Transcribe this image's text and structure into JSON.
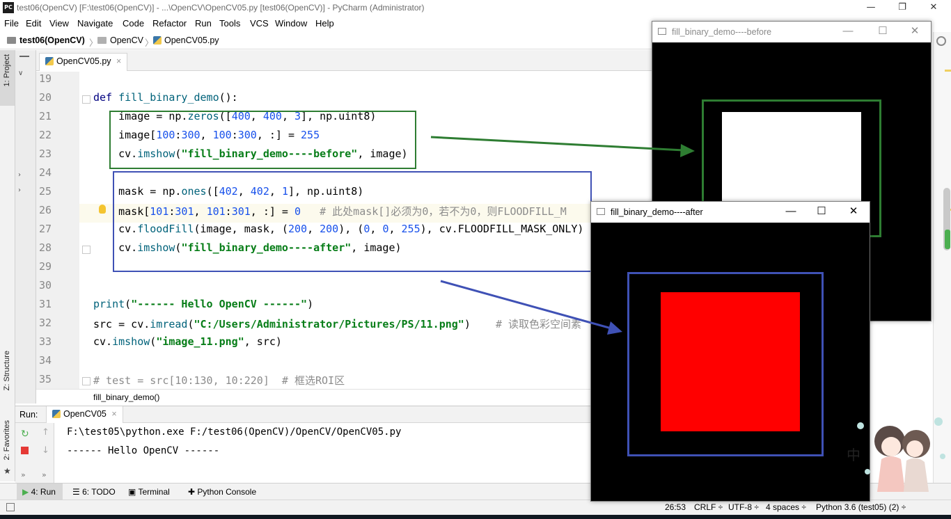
{
  "titlebar": {
    "app_icon": "PC",
    "title": "test06(OpenCV) [F:\\test06(OpenCV)] - ...\\OpenCV\\OpenCV05.py [test06(OpenCV)] - PyCharm (Administrator)",
    "minimize": "—",
    "restore": "❐",
    "close": "✕"
  },
  "menu": [
    "File",
    "Edit",
    "View",
    "Navigate",
    "Code",
    "Refactor",
    "Run",
    "Tools",
    "VCS",
    "Window",
    "Help"
  ],
  "breadcrumb": {
    "project": "test06(OpenCV)",
    "folder": "OpenCV",
    "file": "OpenCV05.py"
  },
  "left_tools": {
    "project": "1: Project",
    "structure": "Z: Structure",
    "favorites": "2: Favorites"
  },
  "editor_tab": {
    "label": "OpenCV05.py",
    "close": "×"
  },
  "line_numbers": [
    "19",
    "20",
    "21",
    "22",
    "23",
    "24",
    "25",
    "26",
    "27",
    "28",
    "29",
    "30",
    "31",
    "32",
    "33",
    "34",
    "35"
  ],
  "code_lines": [
    {
      "segments": []
    },
    {
      "segments": [
        {
          "t": "def ",
          "c": "kw"
        },
        {
          "t": "fill_binary_demo",
          "c": "fn"
        },
        {
          "t": "():",
          "c": ""
        }
      ]
    },
    {
      "segments": [
        {
          "t": "    image = np.",
          "c": ""
        },
        {
          "t": "zeros",
          "c": "fn"
        },
        {
          "t": "([",
          "c": ""
        },
        {
          "t": "400",
          "c": "num"
        },
        {
          "t": ", ",
          "c": ""
        },
        {
          "t": "400",
          "c": "num"
        },
        {
          "t": ", ",
          "c": ""
        },
        {
          "t": "3",
          "c": "num"
        },
        {
          "t": "], np.uint8)",
          "c": ""
        }
      ]
    },
    {
      "segments": [
        {
          "t": "    image[",
          "c": ""
        },
        {
          "t": "100",
          "c": "num"
        },
        {
          "t": ":",
          "c": ""
        },
        {
          "t": "300",
          "c": "num"
        },
        {
          "t": ", ",
          "c": ""
        },
        {
          "t": "100",
          "c": "num"
        },
        {
          "t": ":",
          "c": ""
        },
        {
          "t": "300",
          "c": "num"
        },
        {
          "t": ", :] = ",
          "c": ""
        },
        {
          "t": "255",
          "c": "num"
        }
      ]
    },
    {
      "segments": [
        {
          "t": "    cv.",
          "c": ""
        },
        {
          "t": "imshow",
          "c": "fn"
        },
        {
          "t": "(",
          "c": ""
        },
        {
          "t": "\"fill_binary_demo----before\"",
          "c": "str"
        },
        {
          "t": ", image)",
          "c": ""
        }
      ]
    },
    {
      "segments": []
    },
    {
      "segments": [
        {
          "t": "    mask = np.",
          "c": ""
        },
        {
          "t": "ones",
          "c": "fn"
        },
        {
          "t": "([",
          "c": ""
        },
        {
          "t": "402",
          "c": "num"
        },
        {
          "t": ", ",
          "c": ""
        },
        {
          "t": "402",
          "c": "num"
        },
        {
          "t": ", ",
          "c": ""
        },
        {
          "t": "1",
          "c": "num"
        },
        {
          "t": "], np.uint8)",
          "c": ""
        }
      ]
    },
    {
      "segments": [
        {
          "t": "    mask[",
          "c": ""
        },
        {
          "t": "101",
          "c": "num"
        },
        {
          "t": ":",
          "c": ""
        },
        {
          "t": "301",
          "c": "num"
        },
        {
          "t": ", ",
          "c": ""
        },
        {
          "t": "101",
          "c": "num"
        },
        {
          "t": ":",
          "c": ""
        },
        {
          "t": "301",
          "c": "num"
        },
        {
          "t": ", :] = ",
          "c": ""
        },
        {
          "t": "0",
          "c": "num"
        },
        {
          "t": "   # 此处mask[]必须为0，若不为0，则FLOODFILL_M",
          "c": "cm"
        }
      ]
    },
    {
      "segments": [
        {
          "t": "    cv.",
          "c": ""
        },
        {
          "t": "floodFill",
          "c": "fn"
        },
        {
          "t": "(image, mask, (",
          "c": ""
        },
        {
          "t": "200",
          "c": "num"
        },
        {
          "t": ", ",
          "c": ""
        },
        {
          "t": "200",
          "c": "num"
        },
        {
          "t": "), (",
          "c": ""
        },
        {
          "t": "0",
          "c": "num"
        },
        {
          "t": ", ",
          "c": ""
        },
        {
          "t": "0",
          "c": "num"
        },
        {
          "t": ", ",
          "c": ""
        },
        {
          "t": "255",
          "c": "num"
        },
        {
          "t": "), cv.FLOODFILL_MASK_ONLY)",
          "c": ""
        }
      ]
    },
    {
      "segments": [
        {
          "t": "    cv.",
          "c": ""
        },
        {
          "t": "imshow",
          "c": "fn"
        },
        {
          "t": "(",
          "c": ""
        },
        {
          "t": "\"fill_binary_demo----after\"",
          "c": "str"
        },
        {
          "t": ", image)",
          "c": ""
        }
      ]
    },
    {
      "segments": []
    },
    {
      "segments": []
    },
    {
      "segments": [
        {
          "t": "print",
          "c": "fn"
        },
        {
          "t": "(",
          "c": ""
        },
        {
          "t": "\"------ Hello OpenCV ------\"",
          "c": "str"
        },
        {
          "t": ")",
          "c": ""
        }
      ]
    },
    {
      "segments": [
        {
          "t": "src = cv.",
          "c": ""
        },
        {
          "t": "imread",
          "c": "fn"
        },
        {
          "t": "(",
          "c": ""
        },
        {
          "t": "\"C:/Users/Administrator/Pictures/PS/11.png\"",
          "c": "str"
        },
        {
          "t": ")    ",
          "c": ""
        },
        {
          "t": "# 读取色彩空间素",
          "c": "cm"
        }
      ]
    },
    {
      "segments": [
        {
          "t": "cv.",
          "c": ""
        },
        {
          "t": "imshow",
          "c": "fn"
        },
        {
          "t": "(",
          "c": ""
        },
        {
          "t": "\"image_11.png\"",
          "c": "str"
        },
        {
          "t": ", src)",
          "c": ""
        }
      ]
    },
    {
      "segments": []
    },
    {
      "segments": [
        {
          "t": "# test = src[10:130, 10:220]  # 框选ROI区",
          "c": "cm"
        }
      ]
    }
  ],
  "code_crumb": "fill_binary_demo()",
  "run_panel": {
    "label": "Run:",
    "tab": "OpenCV05",
    "tab_close": "×",
    "output": [
      "F:\\test05\\python.exe F:/test06(OpenCV)/OpenCV/OpenCV05.py",
      "------ Hello OpenCV ------"
    ]
  },
  "bottom_tools": {
    "run": "4: Run",
    "todo": "6: TODO",
    "terminal": "Terminal",
    "python_console": "Python Console"
  },
  "status": {
    "position": "26:53",
    "line_sep": "CRLF ÷",
    "encoding": "UTF-8 ÷",
    "indent": "4 spaces ÷",
    "interpreter": "Python 3.6 (test05) (2) ÷"
  },
  "cv_before": {
    "title": "fill_binary_demo----before",
    "minimize": "—",
    "maximize": "☐",
    "close": "✕",
    "image_size": 400,
    "filled_region": [
      100,
      300
    ],
    "fill_color": "#ffffff"
  },
  "cv_after": {
    "title": "fill_binary_demo----after",
    "minimize": "—",
    "maximize": "☐",
    "close": "✕",
    "image_size": 400,
    "filled_region": [
      100,
      300
    ],
    "fill_color": "#ff0000"
  },
  "annotation_colors": {
    "green": "#2e7d32",
    "blue": "#3f51b5"
  },
  "mascot_char": "中"
}
